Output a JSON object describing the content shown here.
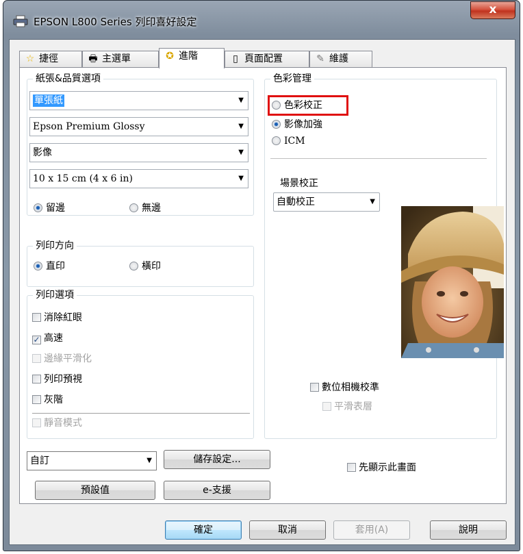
{
  "window": {
    "title": "EPSON L800 Series 列印喜好設定",
    "close_label": "x"
  },
  "tabs": [
    {
      "label": "捷徑",
      "icon": "star-icon"
    },
    {
      "label": "主選單",
      "icon": "printer-icon"
    },
    {
      "label": "進階",
      "icon": "advanced-settings-icon",
      "active": true
    },
    {
      "label": "頁面配置",
      "icon": "page-layout-icon"
    },
    {
      "label": "維護",
      "icon": "wrench-icon"
    }
  ],
  "paper_quality": {
    "title": "紙張&品質選項",
    "source": "單張紙",
    "paper_type": "Epson Premium Glossy",
    "quality": "影像",
    "size": "10 x 15 cm (4 x 6 in)",
    "border_label": "留邊",
    "borderless_label": "無邊",
    "border_selected": "border"
  },
  "orientation": {
    "title": "列印方向",
    "portrait_label": "直印",
    "landscape_label": "橫印",
    "selected": "portrait"
  },
  "print_options": {
    "title": "列印選項",
    "items": [
      {
        "label": "消除紅眼",
        "checked": false,
        "enabled": true
      },
      {
        "label": "高速",
        "checked": true,
        "enabled": true
      },
      {
        "label": "邊緣平滑化",
        "checked": false,
        "enabled": false
      },
      {
        "label": "列印預視",
        "checked": false,
        "enabled": true
      },
      {
        "label": "灰階",
        "checked": false,
        "enabled": true
      },
      {
        "label": "靜音模式",
        "checked": false,
        "enabled": false
      }
    ]
  },
  "color_management": {
    "title": "色彩管理",
    "options": [
      {
        "label": "色彩校正",
        "selected": false
      },
      {
        "label": "影像加強",
        "selected": true
      },
      {
        "label": "ICM",
        "selected": false
      }
    ],
    "scene_label": "場景校正",
    "scene_value": "自動校正",
    "digital_camera_label": "數位相機校準",
    "smooth_skin_label": "平滑表層"
  },
  "bottom": {
    "custom_value": "自訂",
    "save_settings_label": "儲存設定...",
    "defaults_label": "預設值",
    "esupport_label": "e-支援",
    "show_first_label": "先顯示此畫面"
  },
  "dialog_buttons": {
    "ok": "確定",
    "cancel": "取消",
    "apply": "套用(A)",
    "help": "說明"
  },
  "colors": {
    "highlight": "#e01010",
    "selection": "#3399ff",
    "radio_dot": "#1b5fb3"
  }
}
